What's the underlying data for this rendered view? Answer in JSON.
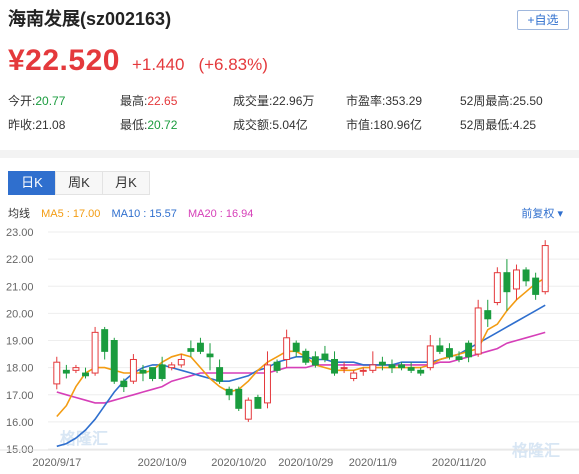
{
  "header": {
    "name": "海南发展(sz002163)",
    "add_button": "+自选"
  },
  "quote": {
    "price": "¥22.520",
    "change": "+1.440",
    "change_pct": "(+6.83%)"
  },
  "stats": [
    [
      {
        "label": "今开:",
        "value": "20.77",
        "tone": "down"
      },
      {
        "label": "最高:",
        "value": "22.65",
        "tone": "up"
      },
      {
        "label": "成交量:",
        "value": "22.96万",
        "tone": "plain"
      },
      {
        "label": "市盈率:",
        "value": "353.29",
        "tone": "plain"
      },
      {
        "label": "52周最高:",
        "value": "25.50",
        "tone": "plain"
      }
    ],
    [
      {
        "label": "昨收:",
        "value": "21.08",
        "tone": "plain"
      },
      {
        "label": "最低:",
        "value": "20.72",
        "tone": "down"
      },
      {
        "label": "成交额:",
        "value": "5.04亿",
        "tone": "plain"
      },
      {
        "label": "市值:",
        "value": "180.96亿",
        "tone": "plain"
      },
      {
        "label": "52周最低:",
        "value": "4.25",
        "tone": "plain"
      }
    ]
  ],
  "tabs": [
    "日K",
    "周K",
    "月K"
  ],
  "ma": {
    "label": "均线",
    "ma5": "MA5 : 17.00",
    "ma10": "MA10 : 15.57",
    "ma20": "MA20 : 16.94",
    "adjust": "前复权 ▾"
  },
  "watermark": [
    "格隆汇",
    "格隆汇"
  ],
  "colors": {
    "up": "#e4393c",
    "down": "#1a9c3e",
    "accent": "#2f6fce",
    "ma5": "#f39c12",
    "ma10": "#2f6fce",
    "ma20": "#d63fb8"
  },
  "chart_data": {
    "type": "candlestick",
    "ylim": [
      15,
      23
    ],
    "yticks": [
      "23.00",
      "22.00",
      "21.00",
      "20.00",
      "19.00",
      "18.00",
      "17.00",
      "16.00",
      "15.00"
    ],
    "xticks": [
      {
        "label": "2020/9/17",
        "index": 0
      },
      {
        "label": "2020/10/9",
        "index": 11
      },
      {
        "label": "2020/10/20",
        "index": 19
      },
      {
        "label": "2020/10/29",
        "index": 26
      },
      {
        "label": "2020/11/9",
        "index": 33
      },
      {
        "label": "2020/11/20",
        "index": 42
      }
    ],
    "candles": [
      {
        "o": 17.4,
        "h": 18.4,
        "l": 17.2,
        "c": 18.2
      },
      {
        "o": 17.9,
        "h": 18.1,
        "l": 17.6,
        "c": 17.8
      },
      {
        "o": 17.9,
        "h": 18.1,
        "l": 17.8,
        "c": 18.0
      },
      {
        "o": 17.8,
        "h": 18.0,
        "l": 17.6,
        "c": 17.7
      },
      {
        "o": 17.8,
        "h": 19.5,
        "l": 17.7,
        "c": 19.3
      },
      {
        "o": 19.4,
        "h": 19.5,
        "l": 18.3,
        "c": 18.6
      },
      {
        "o": 19.0,
        "h": 19.1,
        "l": 17.4,
        "c": 17.5
      },
      {
        "o": 17.5,
        "h": 17.6,
        "l": 17.1,
        "c": 17.3
      },
      {
        "o": 17.5,
        "h": 18.5,
        "l": 17.4,
        "c": 18.3
      },
      {
        "o": 17.9,
        "h": 18.1,
        "l": 17.5,
        "c": 17.8
      },
      {
        "o": 18.0,
        "h": 18.0,
        "l": 17.5,
        "c": 17.6
      },
      {
        "o": 18.1,
        "h": 18.4,
        "l": 17.5,
        "c": 17.6
      },
      {
        "o": 18.0,
        "h": 18.2,
        "l": 17.9,
        "c": 18.1
      },
      {
        "o": 18.1,
        "h": 18.5,
        "l": 18.0,
        "c": 18.3
      },
      {
        "o": 18.7,
        "h": 19.0,
        "l": 18.4,
        "c": 18.6
      },
      {
        "o": 18.9,
        "h": 19.1,
        "l": 18.5,
        "c": 18.6
      },
      {
        "o": 18.5,
        "h": 18.9,
        "l": 17.9,
        "c": 18.4
      },
      {
        "o": 18.0,
        "h": 18.3,
        "l": 17.4,
        "c": 17.5
      },
      {
        "o": 17.2,
        "h": 17.3,
        "l": 16.8,
        "c": 17.0
      },
      {
        "o": 17.2,
        "h": 17.3,
        "l": 16.4,
        "c": 16.5
      },
      {
        "o": 16.1,
        "h": 16.9,
        "l": 16.0,
        "c": 16.8
      },
      {
        "o": 16.9,
        "h": 17.0,
        "l": 16.5,
        "c": 16.5
      },
      {
        "o": 16.7,
        "h": 18.6,
        "l": 16.5,
        "c": 18.1
      },
      {
        "o": 18.2,
        "h": 18.3,
        "l": 17.8,
        "c": 17.9
      },
      {
        "o": 18.3,
        "h": 19.4,
        "l": 18.0,
        "c": 19.1
      },
      {
        "o": 18.9,
        "h": 19.0,
        "l": 18.4,
        "c": 18.6
      },
      {
        "o": 18.6,
        "h": 18.7,
        "l": 18.1,
        "c": 18.2
      },
      {
        "o": 18.4,
        "h": 18.6,
        "l": 18.0,
        "c": 18.1
      },
      {
        "o": 18.5,
        "h": 18.8,
        "l": 18.2,
        "c": 18.3
      },
      {
        "o": 18.3,
        "h": 18.6,
        "l": 17.7,
        "c": 17.8
      },
      {
        "o": 18.0,
        "h": 18.2,
        "l": 17.8,
        "c": 18.0
      },
      {
        "o": 17.6,
        "h": 17.9,
        "l": 17.5,
        "c": 17.8
      },
      {
        "o": 17.9,
        "h": 18.0,
        "l": 17.7,
        "c": 17.9
      },
      {
        "o": 17.9,
        "h": 18.6,
        "l": 17.8,
        "c": 18.1
      },
      {
        "o": 18.2,
        "h": 18.4,
        "l": 17.9,
        "c": 18.1
      },
      {
        "o": 18.1,
        "h": 18.3,
        "l": 17.8,
        "c": 18.0
      },
      {
        "o": 18.1,
        "h": 18.2,
        "l": 17.9,
        "c": 18.0
      },
      {
        "o": 18.0,
        "h": 18.2,
        "l": 17.8,
        "c": 17.9
      },
      {
        "o": 17.9,
        "h": 18.0,
        "l": 17.7,
        "c": 17.8
      },
      {
        "o": 18.0,
        "h": 19.2,
        "l": 17.9,
        "c": 18.8
      },
      {
        "o": 18.8,
        "h": 19.1,
        "l": 18.5,
        "c": 18.6
      },
      {
        "o": 18.7,
        "h": 18.9,
        "l": 18.3,
        "c": 18.4
      },
      {
        "o": 18.4,
        "h": 18.6,
        "l": 18.2,
        "c": 18.3
      },
      {
        "o": 18.9,
        "h": 19.0,
        "l": 18.2,
        "c": 18.4
      },
      {
        "o": 18.5,
        "h": 20.5,
        "l": 18.4,
        "c": 20.2
      },
      {
        "o": 20.1,
        "h": 20.5,
        "l": 19.5,
        "c": 19.8
      },
      {
        "o": 20.4,
        "h": 21.7,
        "l": 20.3,
        "c": 21.5
      },
      {
        "o": 21.5,
        "h": 22.0,
        "l": 20.1,
        "c": 20.8
      },
      {
        "o": 20.9,
        "h": 21.8,
        "l": 20.5,
        "c": 21.6
      },
      {
        "o": 21.6,
        "h": 21.7,
        "l": 21.0,
        "c": 21.2
      },
      {
        "o": 21.3,
        "h": 21.5,
        "l": 20.5,
        "c": 20.7
      },
      {
        "o": 20.8,
        "h": 22.7,
        "l": 20.7,
        "c": 22.5
      }
    ],
    "ma5": [
      16.2,
      16.6,
      17.3,
      17.8,
      18.0,
      18.0,
      17.9,
      17.8,
      17.8,
      17.8,
      17.9,
      18.2,
      18.4,
      18.5,
      18.4,
      18.0,
      17.6,
      17.3,
      17.1,
      17.2,
      17.5,
      17.9,
      18.2,
      18.4,
      18.6,
      18.6,
      18.4,
      18.1,
      18.0,
      17.9,
      17.9,
      17.9,
      18.0,
      18.0,
      18.0,
      18.0,
      18.0,
      18.0,
      18.0,
      18.1,
      18.3,
      18.4,
      18.5,
      18.6,
      18.7,
      19.4,
      19.6,
      20.1,
      20.5,
      20.8,
      21.1,
      21.3
    ],
    "ma10": [
      15.1,
      15.2,
      15.4,
      15.7,
      16.1,
      16.6,
      17.1,
      17.5,
      17.8,
      18.0,
      18.1,
      18.1,
      18.0,
      17.9,
      17.8,
      17.7,
      17.6,
      17.5,
      17.5,
      17.6,
      17.7,
      17.9,
      18.0,
      18.2,
      18.3,
      18.4,
      18.4,
      18.3,
      18.3,
      18.2,
      18.2,
      18.2,
      18.1,
      18.1,
      18.1,
      18.1,
      18.2,
      18.2,
      18.2,
      18.2,
      18.3,
      18.4,
      18.5,
      18.7,
      18.9,
      19.1,
      19.3,
      19.5,
      19.7,
      19.9,
      20.1,
      20.3
    ],
    "ma20": [
      17.1,
      17.0,
      16.9,
      16.8,
      16.7,
      16.7,
      16.8,
      16.9,
      17.0,
      17.1,
      17.2,
      17.3,
      17.5,
      17.6,
      17.7,
      17.8,
      17.8,
      17.8,
      17.8,
      17.8,
      17.8,
      17.8,
      17.8,
      17.9,
      18.0,
      18.0,
      18.0,
      18.1,
      18.1,
      18.1,
      18.1,
      18.1,
      18.1,
      18.1,
      18.1,
      18.1,
      18.1,
      18.1,
      18.1,
      18.1,
      18.2,
      18.2,
      18.3,
      18.4,
      18.5,
      18.6,
      18.7,
      18.9,
      19.0,
      19.1,
      19.2,
      19.3
    ]
  }
}
